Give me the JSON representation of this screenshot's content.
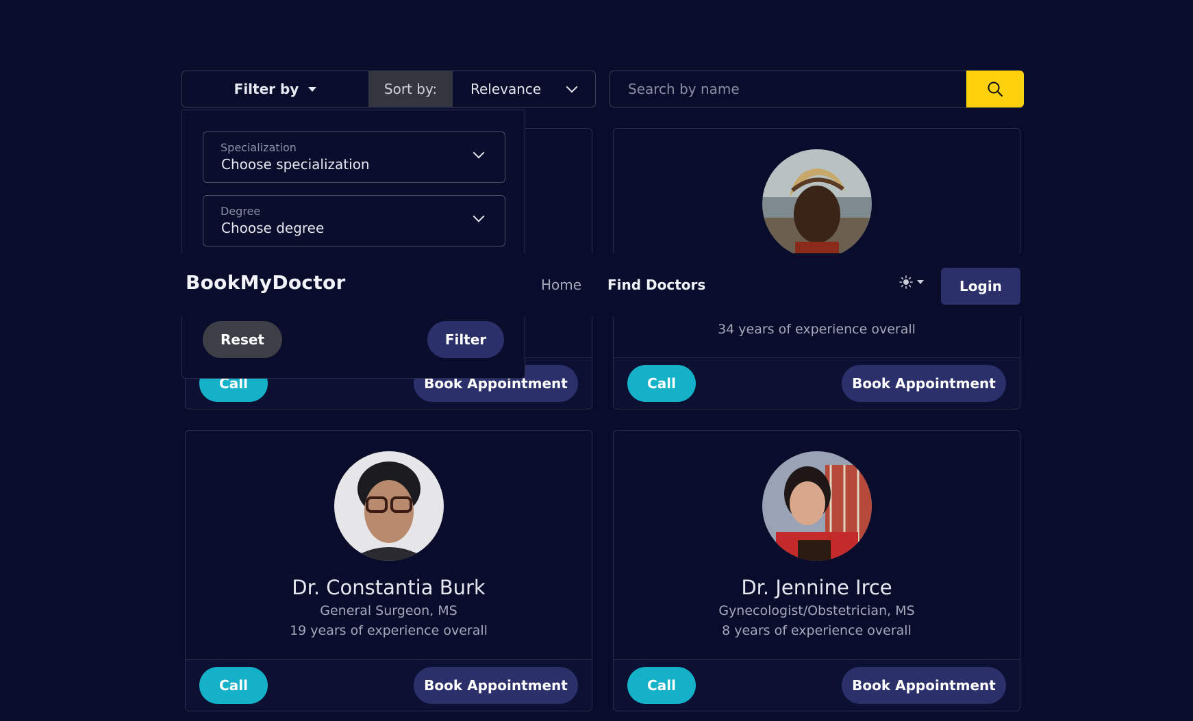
{
  "toolbar": {
    "filter_label": "Filter by",
    "sort_label": "Sort by:",
    "sort_value": "Relevance",
    "search_placeholder": "Search by name"
  },
  "filter_panel": {
    "specialization_label": "Specialization",
    "specialization_value": "Choose specialization",
    "degree_label": "Degree",
    "degree_value": "Choose degree",
    "reset_label": "Reset",
    "filter_label": "Filter"
  },
  "navbar": {
    "brand": "BookMyDoctor",
    "home": "Home",
    "find_doctors": "Find Doctors",
    "login": "Login"
  },
  "doctors": [
    {
      "name": "",
      "specialization": "",
      "experience": "",
      "call": "Call",
      "book": "Book Appointment"
    },
    {
      "name": "",
      "specialization": "",
      "experience": "34 years of experience overall",
      "call": "Call",
      "book": "Book Appointment"
    },
    {
      "name": "Dr. Constantia Burk",
      "specialization": "General Surgeon, MS",
      "experience": "19 years of experience overall",
      "call": "Call",
      "book": "Book Appointment"
    },
    {
      "name": "Dr. Jennine Irce",
      "specialization": "Gynecologist/Obstetrician, MS",
      "experience": "8 years of experience overall",
      "call": "Call",
      "book": "Book Appointment"
    }
  ],
  "colors": {
    "background": "#090c2a",
    "accent_cyan": "#14b1c9",
    "accent_yellow": "#ffd00c",
    "button_navy": "#2b2f6a"
  }
}
